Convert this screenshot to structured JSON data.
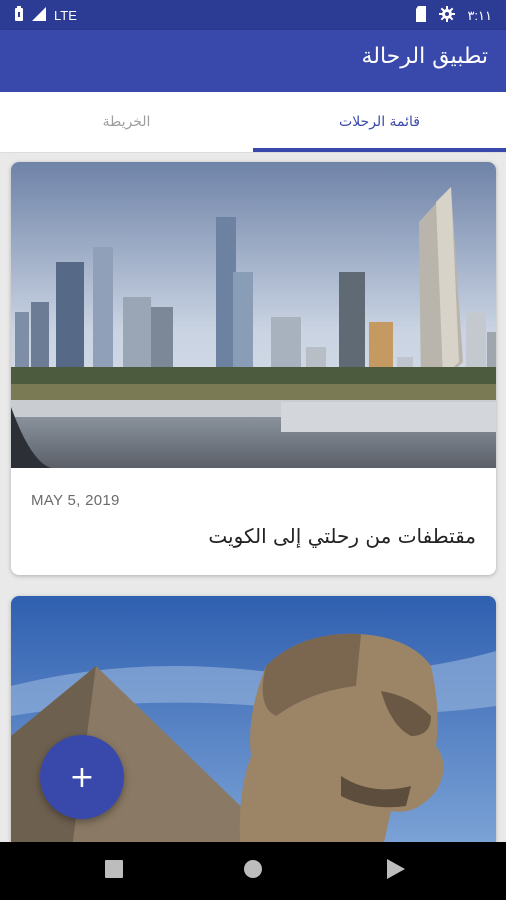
{
  "status_bar": {
    "network": "LTE",
    "time": "٣:١١"
  },
  "app_bar": {
    "title": "تطبيق الرحالة"
  },
  "tabs": [
    {
      "label": "قائمة الرحلات",
      "selected": true
    },
    {
      "label": "الخريطة",
      "selected": false
    }
  ],
  "trips": [
    {
      "date": "MAY 5, 2019",
      "title": "مقتطفات من رحلتي إلى الكويت"
    }
  ],
  "fab": {
    "icon": "plus-icon",
    "label": "+"
  },
  "nav_bar": {
    "icons": [
      "recents-square-icon",
      "home-circle-icon",
      "back-triangle-icon"
    ]
  },
  "colors": {
    "primary": "#3949ab",
    "primary_dark": "#2c3b93"
  }
}
